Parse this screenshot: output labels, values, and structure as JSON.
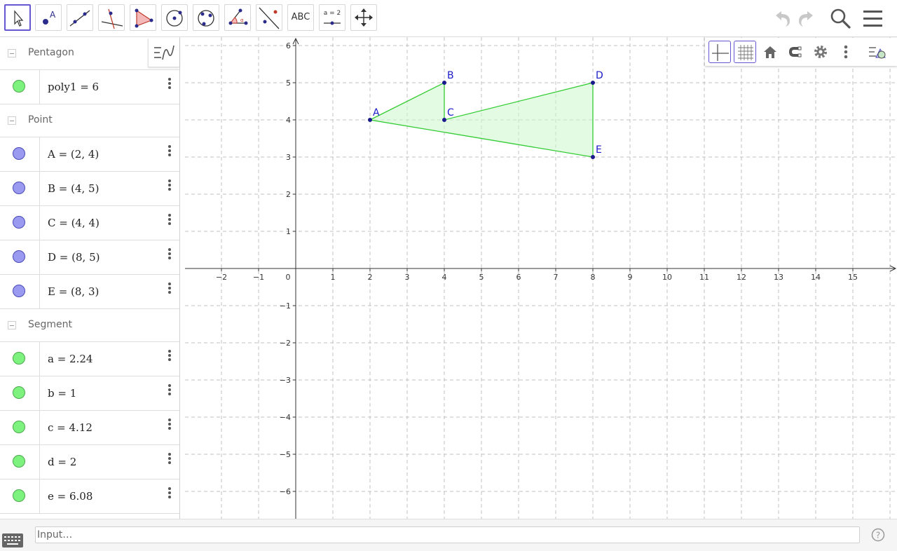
{
  "toolbar": {
    "tools": [
      {
        "name": "move-tool",
        "label": ""
      },
      {
        "name": "point-tool",
        "label": "A"
      },
      {
        "name": "line-tool",
        "label": ""
      },
      {
        "name": "perpendicular-line-tool",
        "label": ""
      },
      {
        "name": "polygon-tool",
        "label": ""
      },
      {
        "name": "circle-center-point-tool",
        "label": ""
      },
      {
        "name": "circle-three-points-tool",
        "label": ""
      },
      {
        "name": "angle-tool",
        "label": ""
      },
      {
        "name": "reflect-tool",
        "label": ""
      },
      {
        "name": "text-tool",
        "label": "ABC"
      },
      {
        "name": "slider-tool",
        "label": "a = 2"
      },
      {
        "name": "move-graphics-tool",
        "label": ""
      }
    ],
    "right_icons": [
      "undo-icon",
      "redo-icon",
      "search-icon",
      "menu-icon"
    ]
  },
  "algebra": {
    "groups": [
      {
        "title": "Pentagon",
        "items": [
          {
            "text": "poly1 = 6",
            "color": "#7ef27e",
            "border": "#4ca94c"
          }
        ]
      },
      {
        "title": "Point",
        "items": [
          {
            "text": "A = (2, 4)",
            "color": "#9a9af0",
            "border": "#4a4ab8"
          },
          {
            "text": "B = (4, 5)",
            "color": "#9a9af0",
            "border": "#4a4ab8"
          },
          {
            "text": "C = (4, 4)",
            "color": "#9a9af0",
            "border": "#4a4ab8"
          },
          {
            "text": "D = (8, 5)",
            "color": "#9a9af0",
            "border": "#4a4ab8"
          },
          {
            "text": "E = (8, 3)",
            "color": "#9a9af0",
            "border": "#4a4ab8"
          }
        ]
      },
      {
        "title": "Segment",
        "items": [
          {
            "text": "a = 2.24",
            "color": "#7ef27e",
            "border": "#4ca94c"
          },
          {
            "text": "b = 1",
            "color": "#7ef27e",
            "border": "#4ca94c"
          },
          {
            "text": "c = 4.12",
            "color": "#7ef27e",
            "border": "#4ca94c"
          },
          {
            "text": "d = 2",
            "color": "#7ef27e",
            "border": "#4ca94c"
          },
          {
            "text": "e = 6.08",
            "color": "#7ef27e",
            "border": "#4ca94c"
          }
        ]
      }
    ]
  },
  "graphics": {
    "x_ticks": [
      "−2",
      "−1",
      "0",
      "1",
      "2",
      "3",
      "4",
      "5",
      "6",
      "7",
      "8",
      "9",
      "10",
      "11",
      "12",
      "13",
      "14",
      "15"
    ],
    "y_ticks_pos": [
      "1",
      "2",
      "3",
      "4",
      "5",
      "6"
    ],
    "y_ticks_neg": [
      "−1",
      "−2",
      "−3",
      "−4",
      "−5",
      "−6"
    ],
    "points": [
      {
        "label": "A",
        "x": 2,
        "y": 4
      },
      {
        "label": "B",
        "x": 4,
        "y": 5
      },
      {
        "label": "C",
        "x": 4,
        "y": 4
      },
      {
        "label": "D",
        "x": 8,
        "y": 5
      },
      {
        "label": "E",
        "x": 8,
        "y": 3
      }
    ],
    "polygon_order": [
      "A",
      "B",
      "C",
      "D",
      "E"
    ],
    "fill_color": "#ccf7cc",
    "stroke_color": "#33cc33",
    "point_color": "#1a1a8c",
    "label_color": "#1a1ac8"
  },
  "style_bar": {
    "buttons": [
      "axes-icon",
      "grid-icon",
      "home-icon",
      "magnet-icon",
      "settings-icon",
      "more-icon",
      "style-toggle-icon"
    ]
  },
  "input": {
    "placeholder": "Input…"
  }
}
